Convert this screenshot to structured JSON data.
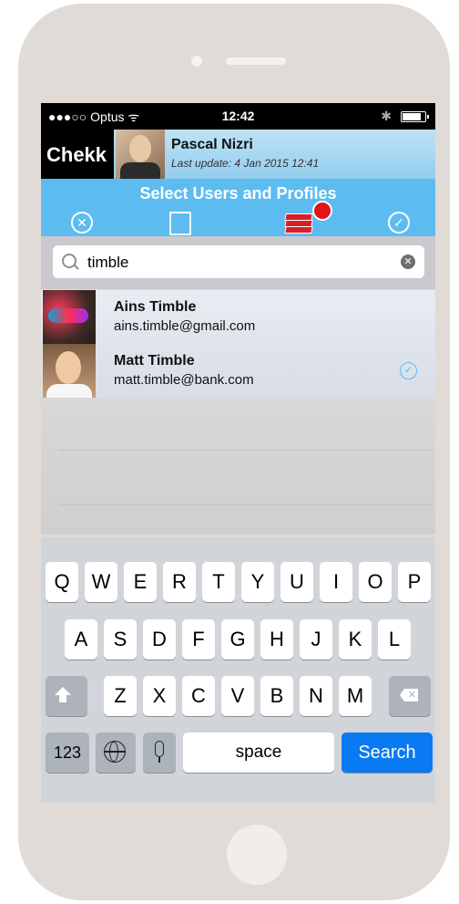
{
  "status_bar": {
    "carrier": "●●●○○ Optus ᯤ",
    "time": "12:42",
    "bluetooth": "✱"
  },
  "header": {
    "logo": "Chekk",
    "user_name": "Pascal Nizri",
    "last_update": "Last update: 4 Jan 2015 12:41"
  },
  "toolbar": {
    "title": "Select Users and Profiles",
    "icons": [
      "cancel-circle-icon",
      "clipboard-check-icon",
      "profiles-stack-icon",
      "confirm-check-circle-icon"
    ]
  },
  "search": {
    "value": "timble",
    "clear": "✕"
  },
  "contacts": [
    {
      "name": "Ains Timble",
      "email": "ains.timble@gmail.com",
      "selected": false
    },
    {
      "name": "Matt Timble",
      "email": "matt.timble@bank.com",
      "selected": true
    }
  ],
  "keyboard": {
    "row1": [
      "Q",
      "W",
      "E",
      "R",
      "T",
      "Y",
      "U",
      "I",
      "O",
      "P"
    ],
    "row2": [
      "A",
      "S",
      "D",
      "F",
      "G",
      "H",
      "J",
      "K",
      "L"
    ],
    "row3": [
      "Z",
      "X",
      "C",
      "V",
      "B",
      "N",
      "M"
    ],
    "numbers": "123",
    "space": "space",
    "search": "Search"
  },
  "colors": {
    "accent": "#5cbcf0",
    "header_bg": "#93cdef",
    "search_key": "#0a7af3",
    "badge": "#e0141a"
  }
}
